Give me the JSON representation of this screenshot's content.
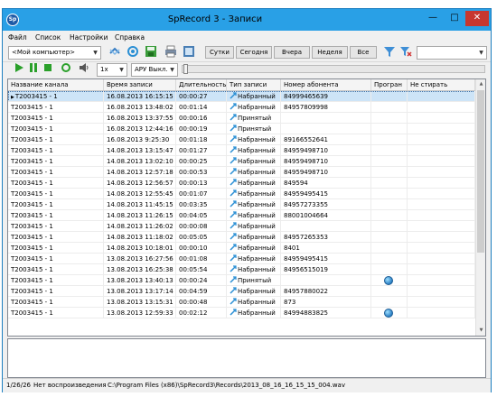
{
  "window": {
    "app_icon": "Sp",
    "title": "SpRecord 3 - Записи",
    "min_glyph": "—",
    "max_glyph": "□",
    "close_glyph": "✕"
  },
  "menu": [
    "Файл",
    "Список",
    "Настройки",
    "Справка"
  ],
  "toolbar": {
    "computer_select": "<Мой компьютер>",
    "period_buttons": [
      "Сутки",
      "Сегодня",
      "Вчера",
      "Неделя",
      "Все"
    ],
    "speed_select": "1x",
    "agc_select": "АРУ Выкл."
  },
  "table": {
    "columns": [
      "Название канала",
      "Время записи",
      "Длительность",
      "Тип записи",
      "Номер абонента",
      "Програн",
      "Не стирать"
    ],
    "rows": [
      {
        "channel": "T2003415 - 1",
        "time": "16.08.2013 16:15:15",
        "duration": "00:00:27",
        "type": "Набранный",
        "number": "84999465639",
        "prog": false,
        "selected": true
      },
      {
        "channel": "T2003415 - 1",
        "time": "16.08.2013 13:48:02",
        "duration": "00:01:14",
        "type": "Набранный",
        "number": "84957809998",
        "prog": false
      },
      {
        "channel": "T2003415 - 1",
        "time": "16.08.2013 13:37:55",
        "duration": "00:00:16",
        "type": "Принятый",
        "number": "",
        "prog": false
      },
      {
        "channel": "T2003415 - 1",
        "time": "16.08.2013 12:44:16",
        "duration": "00:00:19",
        "type": "Принятый",
        "number": "",
        "prog": false
      },
      {
        "channel": "T2003415 - 1",
        "time": "16.08.2013 9:25:30",
        "duration": "00:01:18",
        "type": "Набранный",
        "number": "89166552641",
        "prog": false
      },
      {
        "channel": "T2003415 - 1",
        "time": "14.08.2013 13:15:47",
        "duration": "00:01:27",
        "type": "Набранный",
        "number": "84959498710",
        "prog": false
      },
      {
        "channel": "T2003415 - 1",
        "time": "14.08.2013 13:02:10",
        "duration": "00:00:25",
        "type": "Набранный",
        "number": "84959498710",
        "prog": false
      },
      {
        "channel": "T2003415 - 1",
        "time": "14.08.2013 12:57:18",
        "duration": "00:00:53",
        "type": "Набранный",
        "number": "84959498710",
        "prog": false
      },
      {
        "channel": "T2003415 - 1",
        "time": "14.08.2013 12:56:57",
        "duration": "00:00:13",
        "type": "Набранный",
        "number": "849594",
        "prog": false
      },
      {
        "channel": "T2003415 - 1",
        "time": "14.08.2013 12:55:45",
        "duration": "00:01:07",
        "type": "Набранный",
        "number": "84959495415",
        "prog": false
      },
      {
        "channel": "T2003415 - 1",
        "time": "14.08.2013 11:45:15",
        "duration": "00:03:35",
        "type": "Набранный",
        "number": "84957273355",
        "prog": false
      },
      {
        "channel": "T2003415 - 1",
        "time": "14.08.2013 11:26:15",
        "duration": "00:04:05",
        "type": "Набранный",
        "number": "88001004664",
        "prog": false
      },
      {
        "channel": "T2003415 - 1",
        "time": "14.08.2013 11:26:02",
        "duration": "00:00:08",
        "type": "Набранный",
        "number": "",
        "prog": false
      },
      {
        "channel": "T2003415 - 1",
        "time": "14.08.2013 11:18:02",
        "duration": "00:05:05",
        "type": "Набранный",
        "number": "84957265353",
        "prog": false
      },
      {
        "channel": "T2003415 - 1",
        "time": "14.08.2013 10:18:01",
        "duration": "00:00:10",
        "type": "Набранный",
        "number": "8401",
        "prog": false
      },
      {
        "channel": "T2003415 - 1",
        "time": "13.08.2013 16:27:56",
        "duration": "00:01:08",
        "type": "Набранный",
        "number": "84959495415",
        "prog": false
      },
      {
        "channel": "T2003415 - 1",
        "time": "13.08.2013 16:25:38",
        "duration": "00:05:54",
        "type": "Набранный",
        "number": "84956515019",
        "prog": false
      },
      {
        "channel": "T2003415 - 1",
        "time": "13.08.2013 13:40:13",
        "duration": "00:00:24",
        "type": "Принятый",
        "number": "",
        "prog": true
      },
      {
        "channel": "T2003415 - 1",
        "time": "13.08.2013 13:17:14",
        "duration": "00:04:59",
        "type": "Набранный",
        "number": "84957880022",
        "prog": false
      },
      {
        "channel": "T2003415 - 1",
        "time": "13.08.2013 13:15:31",
        "duration": "00:00:48",
        "type": "Набранный",
        "number": "873",
        "prog": false
      },
      {
        "channel": "T2003415 - 1",
        "time": "13.08.2013 12:59:33",
        "duration": "00:02:12",
        "type": "Набранный",
        "number": "84994883825",
        "prog": true
      }
    ]
  },
  "status": {
    "count": "1/26/26",
    "state": "Нет воспроизведения",
    "path": "C:\\Program Files (x86)\\SpRecord3\\Records\\2013_08_16_16_15_15_004.wav"
  },
  "colors": {
    "titlebar": "#29a0e6",
    "selected_row": "#cde4f7",
    "close_button": "#c7372f"
  }
}
